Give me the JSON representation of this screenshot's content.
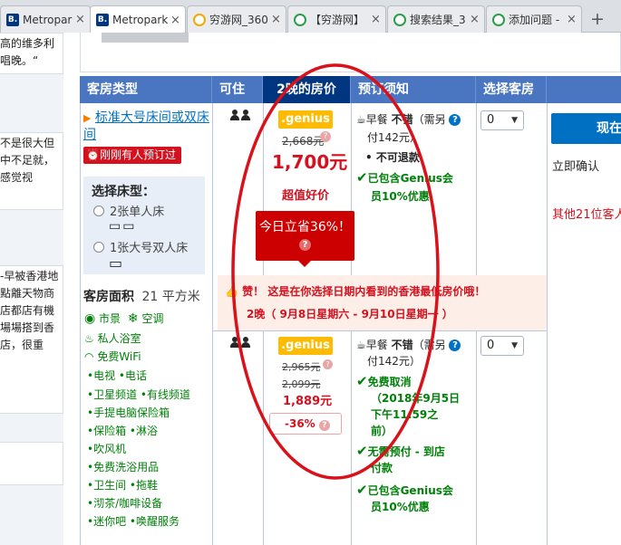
{
  "tabs": [
    {
      "title": "Metropark",
      "icon": "booking-icon"
    },
    {
      "title": "Metropark",
      "icon": "booking-icon"
    },
    {
      "title": "穷游网_360",
      "icon": "qyer-icon"
    },
    {
      "title": "【穷游网】",
      "icon": "qyer-icon"
    },
    {
      "title": "搜索结果_3",
      "icon": "qyer-icon"
    },
    {
      "title": "添加问题 -",
      "icon": "qyer-icon"
    }
  ],
  "new_tab": "+",
  "left_snippets": {
    "s1": "高的维多利唱晚。“",
    "s2": "不是很大但中不足就，感觉视",
    "s3": "-早被香港地點離天物商店都店有機場場搭到香店，很重"
  },
  "table": {
    "headers": {
      "room_type": "客房类型",
      "occupancy": "可住",
      "price": "2晚的房价",
      "conditions": "预订须知",
      "select": "选择客房"
    },
    "room": {
      "name": "标准大号床间或双床间",
      "recent_booking": "刚刚有人预订过",
      "bed_choice_title": "选择床型：",
      "bed_options": [
        "2张单人床",
        "1张大号双人床"
      ],
      "area_label": "客房面积",
      "area_value": "21 平方米",
      "features": [
        {
          "icon": "eye-icon",
          "label": "市景"
        },
        {
          "icon": "snowflake-icon",
          "label": "空调"
        },
        {
          "icon": "bath-icon",
          "label": "私人浴室"
        },
        {
          "icon": "wifi-icon",
          "label": "免费WiFi"
        }
      ],
      "amenities": [
        "•电视",
        "•电话",
        "•卫星频道",
        "•有线频道",
        "•手提电脑保险箱",
        "•保险箱",
        "•淋浴",
        "•吹风机",
        "•免费洗浴用品",
        "•卫生间",
        "•拖鞋",
        "•沏茶/咖啡设备",
        "•迷你吧",
        "•唤醒服务"
      ]
    },
    "offer1": {
      "genius": ".genius",
      "old_price": "2,668元",
      "price": "1,700元",
      "deal_label": "超值好价",
      "savings_tip": "今日立省36%！",
      "breakfast": "早餐 不错（需另付142元）",
      "breakfast_label": "早餐",
      "breakfast_rating": "不错",
      "breakfast_extra1": "（需另",
      "breakfast_extra2": "付142元）",
      "non_refundable": "• 不可退款",
      "genius_discount_1": "已包含Genius会",
      "genius_discount_2": "员10%优惠",
      "qty": "0"
    },
    "banner": {
      "praise": "赞！",
      "message": "这是在你选择日期内看到的香港最低房价哦！",
      "dates": "2晚（ 9月8日星期六 - 9月10日星期一 ）"
    },
    "offer2": {
      "genius": ".genius",
      "old_price_1": "2,965元",
      "old_price_2": "2,099元",
      "price": "1,889元",
      "discount_badge": "-36%",
      "breakfast_label": "早餐",
      "breakfast_rating": "不错",
      "breakfast_extra1": "（需另",
      "breakfast_extra2": "付142元）",
      "free_cancel_1": "免费取消",
      "free_cancel_2": "（2018年9月5日",
      "free_cancel_3": "下午11:59之",
      "free_cancel_4": "前）",
      "no_prepay_1": "无需预付 - 到店",
      "no_prepay_2": "付款",
      "genius_discount_1": "已包含Genius会",
      "genius_discount_2": "员10%优惠",
      "qty": "0"
    },
    "right": {
      "book_button": "现在",
      "instant_confirm": "立即确认",
      "others_viewing": "其他21位客人"
    }
  },
  "colors": {
    "header_blue": "#4a75c0",
    "header_selected": "#003580",
    "price_red": "#d4111e",
    "genius_yellow": "#febb02",
    "green": "#008009",
    "link_blue": "#0071c2",
    "annotation_ellipse": "#d8111a"
  }
}
